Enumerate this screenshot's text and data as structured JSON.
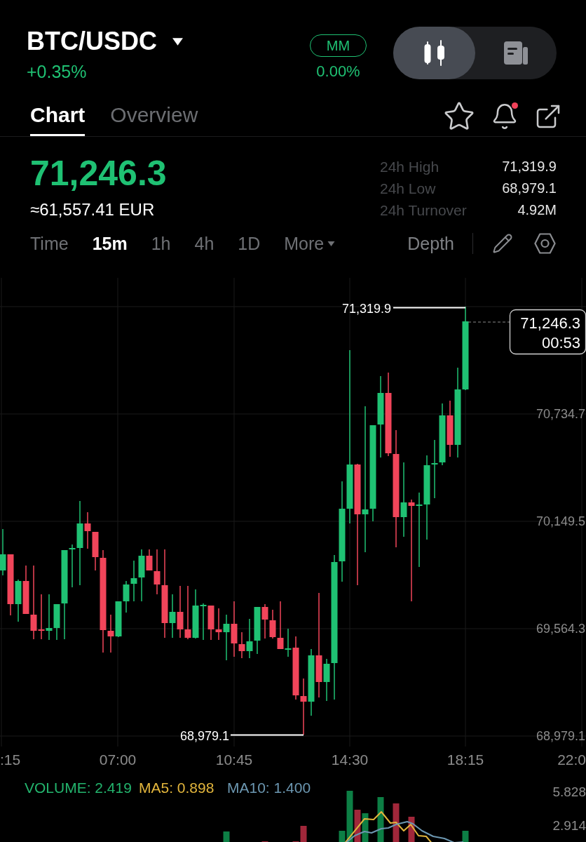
{
  "header": {
    "pair": "BTC/USDC",
    "change": "+0.35%",
    "margin_mode": {
      "label": "MM",
      "value": "0.00%"
    },
    "view_toggle": [
      {
        "kind": "candlestick",
        "selected": true
      },
      {
        "kind": "document",
        "selected": false
      }
    ]
  },
  "tabs": [
    {
      "label": "Chart",
      "selected": true
    },
    {
      "label": "Overview",
      "selected": false
    }
  ],
  "tab_actions": [
    {
      "kind": "star"
    },
    {
      "kind": "bell",
      "notification": true
    },
    {
      "kind": "share"
    }
  ],
  "ticker": {
    "last_price": "71,246.3",
    "converted_price": "≈61,557.41 EUR",
    "stats": [
      {
        "label": "24h High",
        "value": "71,319.9"
      },
      {
        "label": "24h Low",
        "value": "68,979.1"
      },
      {
        "label": "24h Turnover",
        "value": "4.92M"
      }
    ]
  },
  "intervals": [
    {
      "label": "Time",
      "selected": false
    },
    {
      "label": "15m",
      "selected": true
    },
    {
      "label": "1h",
      "selected": false
    },
    {
      "label": "4h",
      "selected": false
    },
    {
      "label": "1D",
      "selected": false
    }
  ],
  "more_menu": {
    "label": "More"
  },
  "depth": {
    "label": "Depth"
  },
  "chart_tools": [
    {
      "kind": "pencil"
    },
    {
      "kind": "settings"
    }
  ],
  "chart": {
    "price_axis": [
      "70,734.7",
      "70,149.5",
      "69,564.3",
      "68,979.1"
    ],
    "time_axis": [
      ":15",
      "07:00",
      "10:45",
      "14:30",
      "18:15",
      "22:0"
    ],
    "high_label": "71,319.9",
    "low_label": "68,979.1",
    "price_tag": {
      "price": "71,246.3",
      "countdown": "00:53"
    }
  },
  "volume": {
    "legend": [
      {
        "kind": "volume",
        "text": "VOLUME: 2.419",
        "color": "#23b46d"
      },
      {
        "kind": "ma5",
        "text": "MA5: 0.898",
        "color": "#e2b53c"
      },
      {
        "kind": "ma10",
        "text": "MA10: 1.400",
        "color": "#6c97b1"
      }
    ],
    "value_axis": [
      "5.828",
      "2.914"
    ]
  }
}
